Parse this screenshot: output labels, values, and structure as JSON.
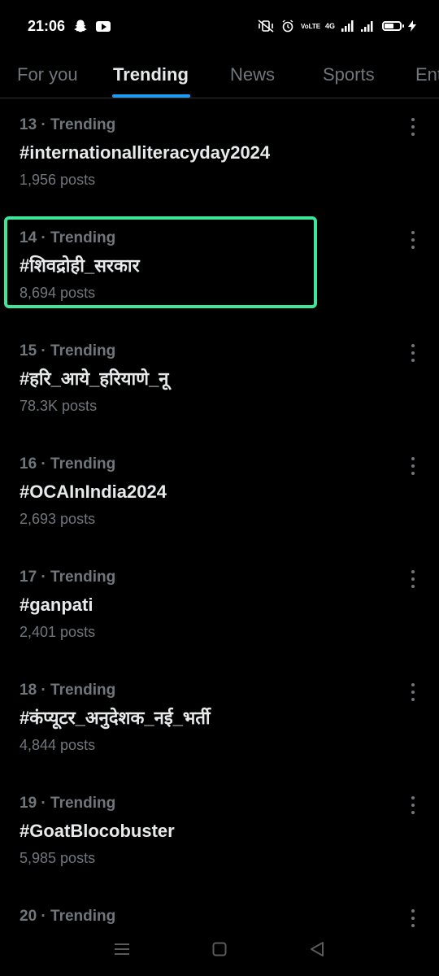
{
  "status_bar": {
    "time": "21:06",
    "network_label": "VoLTE",
    "signal_label": "4G"
  },
  "tabs": [
    {
      "label": "For you",
      "active": false
    },
    {
      "label": "Trending",
      "active": true
    },
    {
      "label": "News",
      "active": false
    },
    {
      "label": "Sports",
      "active": false
    },
    {
      "label": "Ent",
      "active": false
    }
  ],
  "trends": [
    {
      "meta": "13 · Trending",
      "title": "#internationalliteracyday2024",
      "posts": "1,956 posts"
    },
    {
      "meta": "14 · Trending",
      "title": "#शिवद्रोही_सरकार",
      "posts": "8,694 posts"
    },
    {
      "meta": "15 · Trending",
      "title": "#हरि_आये_हरियाणे_नू",
      "posts": "78.3K posts"
    },
    {
      "meta": "16 · Trending",
      "title": "#OCAInIndia2024",
      "posts": "2,693 posts"
    },
    {
      "meta": "17 · Trending",
      "title": "#ganpati",
      "posts": "2,401 posts"
    },
    {
      "meta": "18 · Trending",
      "title": "#कंप्यूटर_अनुदेशक_नई_भर्ती",
      "posts": "4,844 posts"
    },
    {
      "meta": "19 · Trending",
      "title": "#GoatBlocobuster",
      "posts": "5,985 posts"
    },
    {
      "meta": "20 · Trending",
      "title": "",
      "posts": ""
    }
  ],
  "colors": {
    "accent": "#1d9bf0",
    "highlight": "#3ee59a",
    "muted": "#71767b",
    "background": "#000000"
  }
}
